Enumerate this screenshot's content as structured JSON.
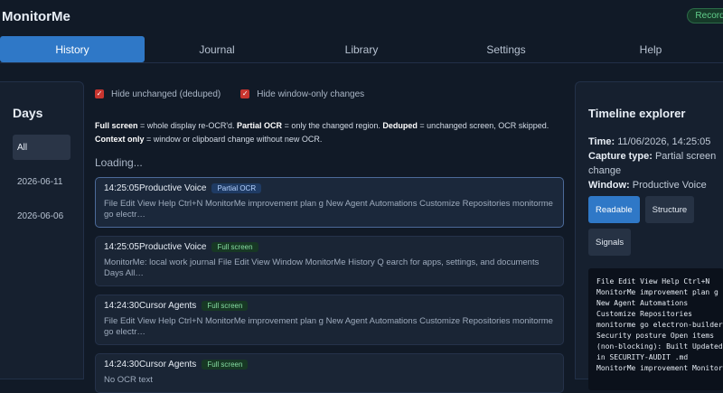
{
  "app": {
    "title": "MonitorMe",
    "record_badge": "Recording"
  },
  "tabs": [
    {
      "label": "History"
    },
    {
      "label": "Journal"
    },
    {
      "label": "Library"
    },
    {
      "label": "Settings"
    },
    {
      "label": "Help"
    }
  ],
  "days": {
    "title": "Days",
    "items": [
      {
        "label": "All"
      },
      {
        "label": "2026-06-11"
      },
      {
        "label": "2026-06-06"
      }
    ]
  },
  "filters": {
    "hide_unchanged": "Hide unchanged (deduped)",
    "hide_window_only": "Hide window-only changes"
  },
  "legend": {
    "full_label": "Full screen",
    "full_text": " = whole display re-OCR'd. ",
    "partial_label": "Partial OCR",
    "partial_text": " = only the changed region. ",
    "deduped_label": "Deduped",
    "deduped_text": " = unchanged screen, OCR skipped. ",
    "context_label": "Context only",
    "context_text": " = window or clipboard change without new OCR."
  },
  "loading": "Loading...",
  "entries": [
    {
      "time": "14:25:05",
      "app": "Productive Voice",
      "badge": "Partial OCR",
      "text": "File Edit View Help Ctrl+N MonitorMe improvement plan g New Agent Automations Customize Repositories monitorme go electr…"
    },
    {
      "time": "14:25:05",
      "app": "Productive Voice",
      "badge": "Full screen",
      "text": "MonitorMe: local work journal File Edit View Window MonitorMe History Q earch for apps, settings, and documents Days All…"
    },
    {
      "time": "14:24:30",
      "app": "Cursor Agents",
      "badge": "Full screen",
      "text": "File Edit View Help Ctrl+N MonitorMe improvement plan g New Agent Automations Customize Repositories monitorme go electr…"
    },
    {
      "time": "14:24:30",
      "app": "Cursor Agents",
      "badge": "Full screen",
      "text": "No OCR text"
    }
  ],
  "explorer": {
    "title": "Timeline explorer",
    "time_label": "Time:",
    "time_value": " 11/06/2026, 14:25:05",
    "capture_label": "Capture type:",
    "capture_value": " Partial screen change",
    "window_label": "Window:",
    "window_value": " Productive Voice",
    "buttons": [
      {
        "label": "Readable"
      },
      {
        "label": "Structure"
      },
      {
        "label": "Signals"
      }
    ],
    "ocr_text": "File Edit View Help Ctrl+N MonitorMe improvement plan g New Agent Automations Customize Repositories monitorme go electron-builder Security posture Open items (non-blocking): Built Updated in SECURITY-AUDIT .md MonitorMe improvement Monitor"
  }
}
